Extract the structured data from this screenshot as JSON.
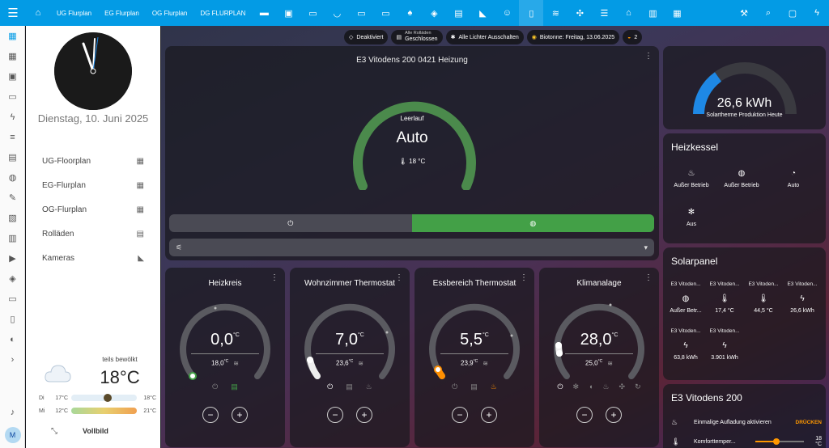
{
  "topbar": {
    "menu_icon": "menu-icon",
    "tabs": [
      "UG Flurplan",
      "EG Flurplan",
      "OG Flurplan",
      "DG FLURPLAN"
    ],
    "icons": [
      "home-icon",
      "sofa-icon",
      "table-icon",
      "bed-icon",
      "bathtub-icon",
      "bed-icon",
      "bed-icon",
      "lamp-icon",
      "gamepad-icon",
      "garage-icon",
      "robot-vacuum-icon",
      "person-icon",
      "elevator-icon",
      "heat-pump-icon",
      "fan-icon",
      "server-icon",
      "house-icon",
      "trash-icon",
      "garage-door-icon",
      "tools-icon",
      "search-icon",
      "chat-icon",
      "flash-icon"
    ]
  },
  "sidebar": {
    "icons": [
      "dashboard-icon",
      "dashboard-icon",
      "contacts-icon",
      "monitor-icon",
      "lightning-icon",
      "list-icon",
      "calendar-icon",
      "globe-icon",
      "wrench-icon",
      "file-search-icon",
      "store-icon",
      "play-icon",
      "gamepad-icon",
      "terminal-icon",
      "clipboard-icon",
      "compass-icon",
      "chevron-icon"
    ],
    "bell": "bell-icon",
    "avatar": "M"
  },
  "leftpanel": {
    "date": "Dienstag, 10. Juni 2025",
    "nav": [
      {
        "label": "UG-Floorplan",
        "icon": "floorplan-icon"
      },
      {
        "label": "EG-Flurplan",
        "icon": "floorplan-icon"
      },
      {
        "label": "OG-Flurplan",
        "icon": "floorplan-icon"
      },
      {
        "label": "Rolläden",
        "icon": "blinds-icon"
      },
      {
        "label": "Kameras",
        "icon": "cctv-icon"
      }
    ],
    "weather": {
      "condition": "teils bewölkt",
      "temp": "18°C",
      "rows": [
        {
          "day": "Di",
          "low": "17°C",
          "high": "18°C"
        },
        {
          "day": "Mi",
          "low": "12°C",
          "high": "21°C"
        }
      ]
    },
    "fullscreen": "Vollbild"
  },
  "chips": [
    {
      "icon": "shield-off-icon",
      "label": "Deaktiviert"
    },
    {
      "icon": "blinds-icon",
      "small": "Alle Rolläden",
      "label": "Geschlossen"
    },
    {
      "icon": "lightbulb-group-icon",
      "label": "Alle Lichter Ausschalten"
    },
    {
      "icon": "eye-icon",
      "label": "Biotonne: Freitag, 13.06.2025"
    },
    {
      "icon": "sun-icon",
      "label": "2"
    }
  ],
  "mainclimate": {
    "title": "E3 Vitodens 200 0421 Heizung",
    "action": "Leerlauf",
    "mode": "Auto",
    "current": "18 °C",
    "modes": [
      "power-icon",
      "heat-auto-icon"
    ],
    "target_fraction": 1.0
  },
  "thermostats": [
    {
      "title": "Heizkreis",
      "target": "0,0",
      "unit": "°C",
      "current": "18,0",
      "current_unit": "°C",
      "target_level": 0.0,
      "icons": [
        "power-icon",
        "calendar-icon"
      ]
    },
    {
      "title": "Wohnzimmer Thermostat",
      "target": "7,0",
      "unit": "°C",
      "current": "23,6",
      "current_unit": "°C",
      "target_level": 0.1,
      "icons": [
        "power-icon",
        "calendar-icon",
        "fire-icon"
      ]
    },
    {
      "title": "Essbereich Thermostat",
      "target": "5,5",
      "unit": "°C",
      "current": "23,9",
      "current_unit": "°C",
      "target_level": 0.05,
      "icons": [
        "power-icon",
        "calendar-icon",
        "fire-icon"
      ]
    },
    {
      "title": "Klimanalage",
      "target": "28,0",
      "unit": "°C",
      "current": "25,0",
      "current_unit": "°C",
      "target_level": 0.3,
      "icons": [
        "power-icon",
        "snowflake-icon",
        "water-icon",
        "fire-icon",
        "fan-icon",
        "sync-icon"
      ]
    }
  ],
  "solar_gauge": {
    "value": "26,6 kWh",
    "label": "Solartherme Produktion Heute",
    "fill": 0.3
  },
  "heizkessel": {
    "title": "Heizkessel",
    "entities": [
      {
        "icon": "flame-off-icon",
        "state": "Außer Betrieb"
      },
      {
        "icon": "heat-pump-icon",
        "state": "Außer Betrieb"
      },
      {
        "icon": "gauge-icon",
        "state": "Auto"
      },
      {
        "icon": "snowflake-icon",
        "state": "Aus"
      }
    ]
  },
  "solarpanel": {
    "title": "Solarpanel",
    "entities": [
      {
        "name": "E3 Vitoden...",
        "icon": "heat-pump-icon",
        "state": "Außer Betr..."
      },
      {
        "name": "E3 Vitoden...",
        "icon": "thermometer-icon",
        "state": "17,4 °C"
      },
      {
        "name": "E3 Vitoden...",
        "icon": "thermometer-icon",
        "state": "44,5 °C"
      },
      {
        "name": "E3 Vitoden...",
        "icon": "flash-icon",
        "state": "26,6 kWh"
      },
      {
        "name": "E3 Vitoden...",
        "icon": "flash-icon",
        "state": "63,8 kWh"
      },
      {
        "name": "E3 Vitoden...",
        "icon": "flash-icon",
        "state": "3.901 kWh"
      }
    ]
  },
  "vitodens": {
    "title": "E3 Vitodens 200",
    "row1": {
      "label": "Einmalige Aufladung aktivieren",
      "action": "DRÜCKEN"
    },
    "row2": {
      "label": "Komforttemper...",
      "value": "18 °C",
      "level": 0.3
    }
  }
}
